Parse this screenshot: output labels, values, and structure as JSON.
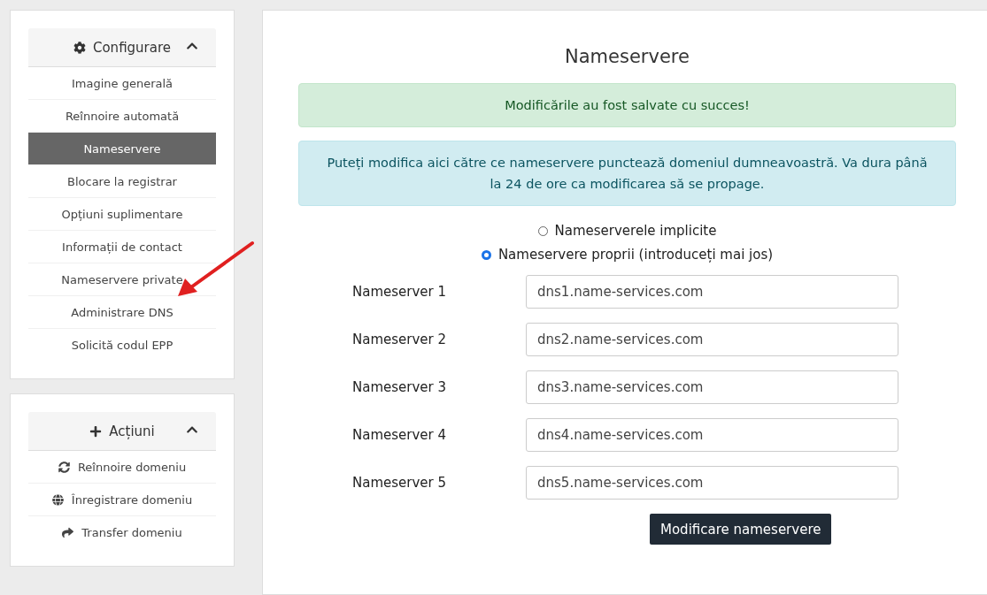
{
  "sidebar": {
    "panels": [
      {
        "kind": "settings",
        "title": "Configurare",
        "expanded": true,
        "items": [
          {
            "label": "Imagine generală",
            "selected": false
          },
          {
            "label": "Reînnoire automată",
            "selected": false
          },
          {
            "label": "Nameservere",
            "selected": true
          },
          {
            "label": "Blocare la registrar",
            "selected": false
          },
          {
            "label": "Opțiuni suplimentare",
            "selected": false
          },
          {
            "label": "Informații de contact",
            "selected": false
          },
          {
            "label": "Nameservere private",
            "selected": false
          },
          {
            "label": "Administrare DNS",
            "selected": false
          },
          {
            "label": "Solicită codul EPP",
            "selected": false
          }
        ]
      },
      {
        "kind": "actions",
        "title": "Acțiuni",
        "expanded": true,
        "items": [
          {
            "label": "Reînnoire domeniu",
            "kind": "renew",
            "selected": false
          },
          {
            "label": "Înregistrare domeniu",
            "kind": "register",
            "selected": false
          },
          {
            "label": "Transfer domeniu",
            "kind": "transfer",
            "selected": false
          }
        ]
      }
    ]
  },
  "main": {
    "title": "Nameservere",
    "success_alert": "Modificările au fost salvate cu succes!",
    "info_alert": "Puteți modifica aici către ce nameservere punctează domeniul dumneavoastră. Va dura până la 24 de ore ca modificarea să se propage.",
    "options": [
      {
        "label": "Nameserverele implicite",
        "selected": false
      },
      {
        "label": "Nameservere proprii (introduceți mai jos)",
        "selected": true
      }
    ],
    "nameservers": [
      {
        "label": "Nameserver 1",
        "value": "dns1.name-services.com"
      },
      {
        "label": "Nameserver 2",
        "value": "dns2.name-services.com"
      },
      {
        "label": "Nameserver 3",
        "value": "dns3.name-services.com"
      },
      {
        "label": "Nameserver 4",
        "value": "dns4.name-services.com"
      },
      {
        "label": "Nameserver 5",
        "value": "dns5.name-services.com"
      }
    ],
    "submit": "Modificare nameservere"
  }
}
